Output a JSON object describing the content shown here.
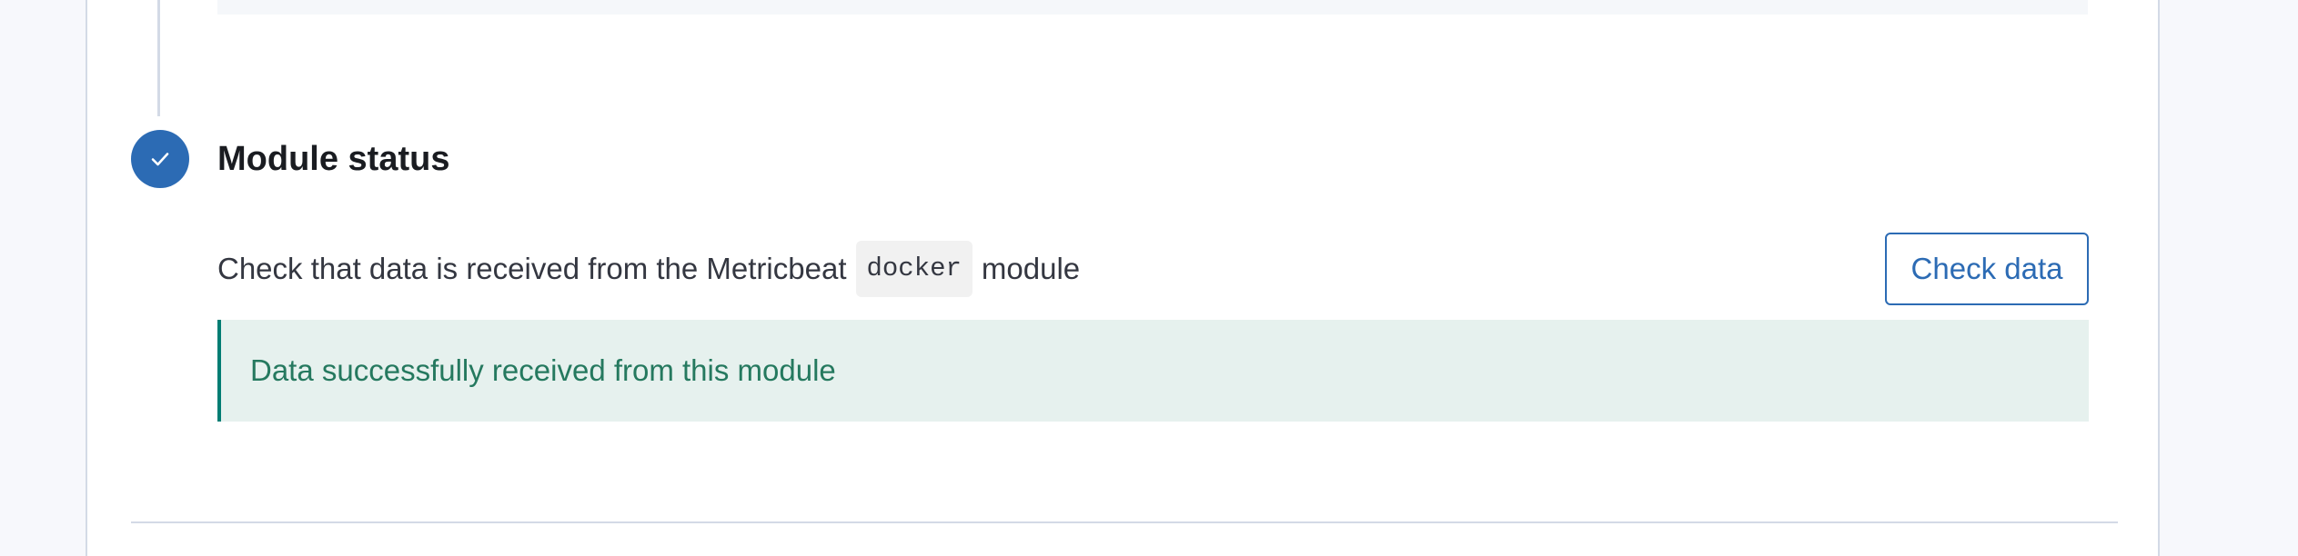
{
  "step": {
    "title": "Module status",
    "status_icon": "check-icon",
    "accent_color": "#2c6bb4"
  },
  "description": {
    "prefix": "Check that data is received from the Metricbeat",
    "code": "docker",
    "suffix": "module"
  },
  "actions": {
    "check_data_label": "Check data"
  },
  "callout": {
    "message": "Data successfully received from this module",
    "status": "success",
    "color": "#25795f"
  }
}
